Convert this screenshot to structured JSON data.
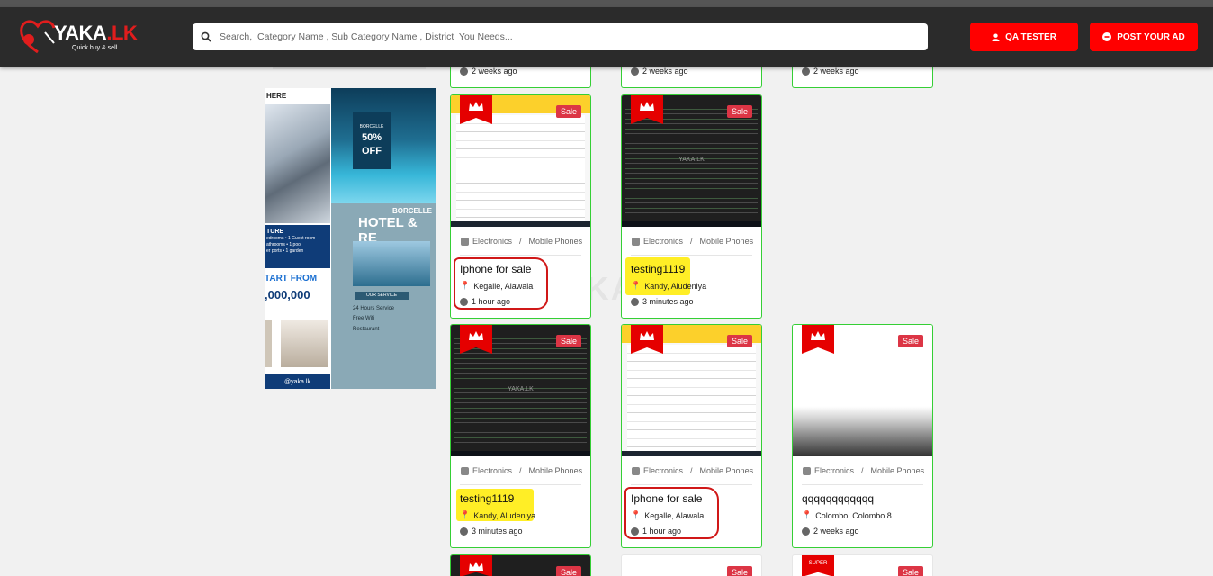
{
  "header": {
    "logo_text": "YAKA",
    "logo_suffix": ".LK",
    "logo_tagline": "Quick buy & sell",
    "search_placeholder": "Search,  Category Name , Sub Category Name , District  You Needs...",
    "qa_button": "QA TESTER",
    "post_button": "POST YOUR AD",
    "brand_color": "#ff0000"
  },
  "banner": {
    "here": "HERE",
    "features_title": "TURE",
    "feature_lines": [
      "edrooms   • 1 Guest room",
      "athrooms   • 1 pool",
      "er ports     • 1 garden"
    ],
    "start_from": "TART FROM",
    "price": ",000,000",
    "footer": "@yaka.lk",
    "badge_brand": "BORCELLE",
    "badge_pct": "50%",
    "badge_off": "OFF",
    "hotel_small": "BORCELLE",
    "hotel_big": "HOTEL & RE",
    "service_title": "OUR SERVICE",
    "services": [
      "24 Hours Service",
      "Free Wifi",
      "Restaurant"
    ]
  },
  "watermark": "YAKA.LK",
  "partial_top": [
    {
      "time": "2 weeks ago"
    },
    {
      "time": "2 weeks ago"
    },
    {
      "time": "2 weeks ago"
    }
  ],
  "listings": [
    {
      "category": "Electronics",
      "subcategory": "Mobile Phones",
      "title": "Iphone for sale",
      "location": "Kegalle, Alawala",
      "time": "1 hour ago",
      "badge": "Sale"
    },
    {
      "category": "Electronics",
      "subcategory": "Mobile Phones",
      "title": "testing1119",
      "location": "Kandy, Aludeniya",
      "time": "3 minutes ago",
      "badge": "Sale"
    },
    {
      "category": "Electronics",
      "subcategory": "Mobile Phones",
      "title": "testing1119",
      "location": "Kandy, Aludeniya",
      "time": "3 minutes ago",
      "badge": "Sale"
    },
    {
      "category": "Electronics",
      "subcategory": "Mobile Phones",
      "title": "Iphone for sale",
      "location": "Kegalle, Alawala",
      "time": "1 hour ago",
      "badge": "Sale"
    },
    {
      "category": "Electronics",
      "subcategory": "Mobile Phones",
      "title": "qqqqqqqqqqqq",
      "location": "Colombo, Colombo 8",
      "time": "2 weeks ago",
      "badge": "Sale"
    }
  ],
  "partial_bottom": [
    {
      "badge": "Sale"
    },
    {
      "badge": "Sale"
    },
    {
      "badge": "Sale",
      "label": "SUPER"
    }
  ]
}
